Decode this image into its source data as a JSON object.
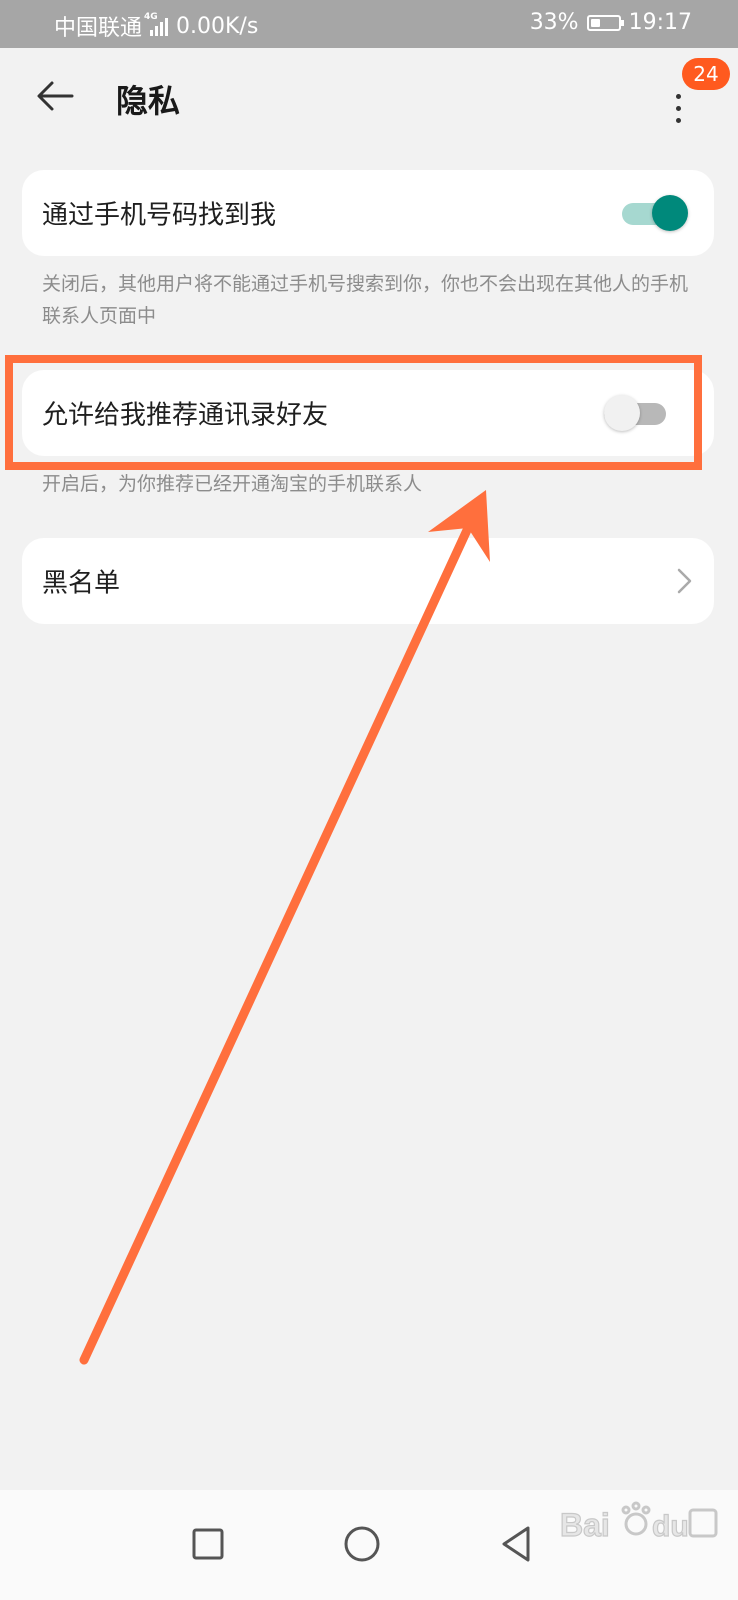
{
  "status_bar": {
    "carrier": "中国联通",
    "network_type": "4G",
    "speed": "0.00K/s",
    "battery_percent": "33%",
    "battery_level": 0.33,
    "time": "19:17"
  },
  "app_bar": {
    "back_icon": "arrow-left-icon",
    "title": "隐私",
    "more_icon": "more-vertical-icon",
    "badge_count": "24"
  },
  "settings": [
    {
      "label": "通过手机号码找到我",
      "toggle": "on",
      "description": "关闭后，其他用户将不能通过手机号搜索到你，你也不会出现在其他人的手机联系人页面中"
    },
    {
      "label": "允许给我推荐通讯录好友",
      "toggle": "off",
      "description": "开启后，为你推荐已经开通淘宝的手机联系人"
    },
    {
      "label": "黑名单",
      "chevron_icon": "chevron-right-icon"
    }
  ],
  "annotation": {
    "highlight_color": "#ff6f3d",
    "target": "允许给我推荐通讯录好友"
  },
  "nav_bar": {
    "recent_icon": "square-icon",
    "home_icon": "circle-icon",
    "back_icon": "triangle-back-icon"
  },
  "colors": {
    "toggle_on": "#00897b",
    "badge": "#ff5a1f",
    "background": "#f2f2f2"
  }
}
